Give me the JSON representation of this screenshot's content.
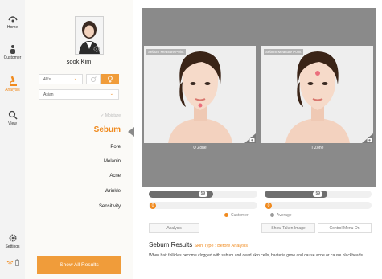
{
  "sidebar": {
    "items": [
      {
        "label": "Home",
        "icon": "home-icon"
      },
      {
        "label": "Customer",
        "icon": "customer-icon"
      },
      {
        "label": "Analysis",
        "icon": "microscope-icon"
      },
      {
        "label": "View",
        "icon": "magnifier-icon"
      }
    ],
    "settings_label": "Settings",
    "active": "Analysis"
  },
  "profile": {
    "name": "sook Kim",
    "age_value": "40's",
    "ethnicity_value": "Asian"
  },
  "menu": {
    "moisture_label": "Moisture",
    "items": [
      "Sebum",
      "Pore",
      "Melanin",
      "Acne",
      "Wrinkle",
      "Sensitivity"
    ],
    "active": "Sebum"
  },
  "show_all_label": "Show All Results",
  "zones": [
    {
      "tag": "Sebum Measure Point",
      "label": "U Zone"
    },
    {
      "tag": "Sebum Measure Point",
      "label": "T Zone"
    }
  ],
  "bars": {
    "u_zone": {
      "average_value": "59",
      "average_fraction": 0.59,
      "customer_value": "0"
    },
    "t_zone": {
      "average_value": "59",
      "average_fraction": 0.59,
      "customer_value": "0"
    }
  },
  "legend": {
    "customer": "Customer",
    "average": "Average"
  },
  "buttons": {
    "analysis": "Analysis",
    "show_taken_image": "Show Taken Image",
    "control_menu": "Control Menu On"
  },
  "results": {
    "title": "Sebum Results",
    "subtitle": "Skin Type : Before Analysis",
    "description": "When hair follicles become clogged with sebum and dead skin cells, bacteria grow and cause acne or cause blackheads."
  },
  "colors": {
    "accent": "#f08a1e",
    "bar_dark": "#6e6e6e"
  }
}
